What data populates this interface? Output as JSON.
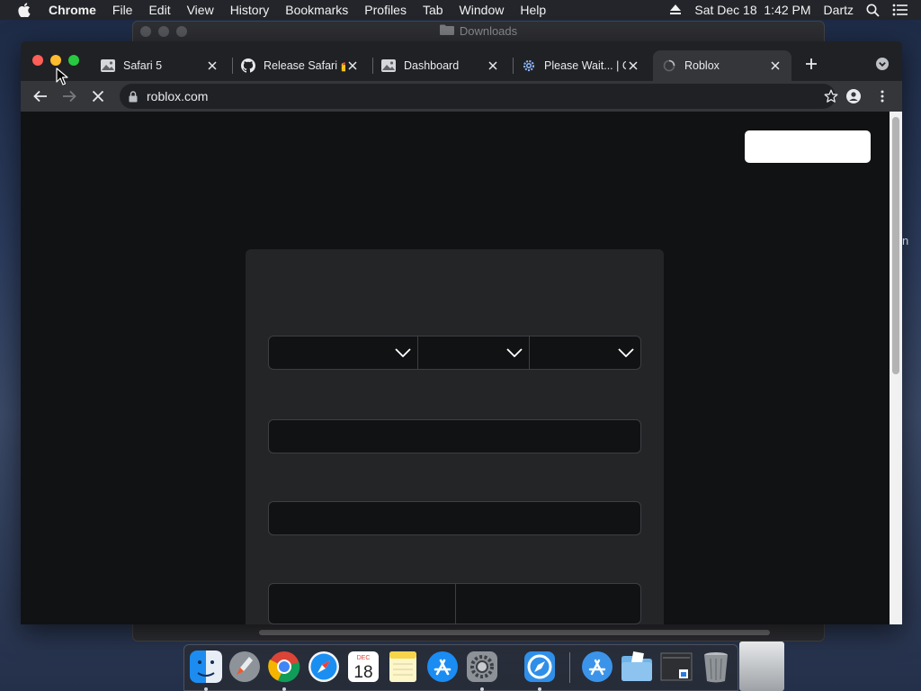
{
  "menubar": {
    "app_name": "Chrome",
    "items": [
      "File",
      "Edit",
      "View",
      "History",
      "Bookmarks",
      "Profiles",
      "Tab",
      "Window",
      "Help"
    ],
    "datetime": "Sat Dec 18  1:42 PM",
    "user": "Dartz"
  },
  "finder_window": {
    "title": "Downloads"
  },
  "browser": {
    "tabs": [
      {
        "label": "Safari 5",
        "icon": "image-favicon",
        "active": false
      },
      {
        "label": "Release Safari 💅",
        "icon": "github-icon",
        "active": false
      },
      {
        "label": "Dashboard",
        "icon": "image-favicon",
        "active": false
      },
      {
        "label": "Please Wait... | C",
        "icon": "gear-favicon",
        "active": false
      },
      {
        "label": "Roblox",
        "icon": "loading-spinner-icon",
        "active": true
      }
    ],
    "url": "roblox.com",
    "state": "loading"
  },
  "page": {
    "background": "#111214",
    "card_color": "#232527",
    "button_color": "#ffffff"
  },
  "background_side_text": "n",
  "dock": {
    "icons": [
      "finder-icon",
      "launchpad-icon",
      "chrome-icon",
      "safari-icon",
      "calendar-icon",
      "notes-icon",
      "app-store-icon",
      "system-preferences-icon",
      "safari-classic-icon",
      "applications-folder-icon",
      "documents-folder-icon",
      "downloads-stack-icon",
      "trash-icon"
    ],
    "calendar": {
      "month": "DEC",
      "day": "18"
    }
  }
}
